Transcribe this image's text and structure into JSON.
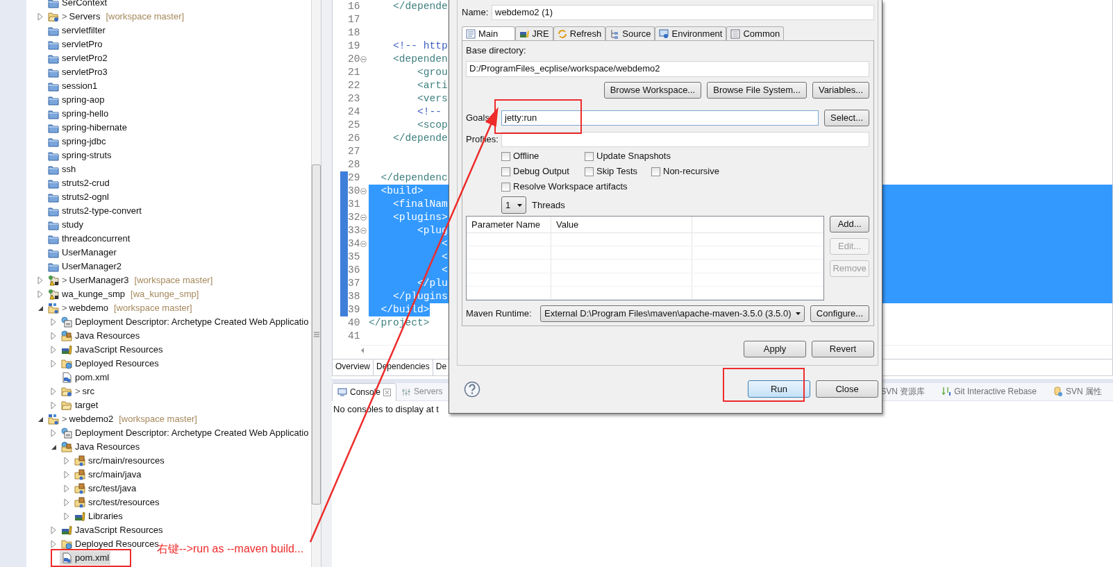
{
  "tree": {
    "items": [
      {
        "label": "SerContext",
        "kind": "closed-project",
        "selected": false
      },
      {
        "label": "Servers",
        "kind": "git-folder",
        "prefix": ">",
        "decoration": "[workspace master]",
        "expanded": false,
        "selected": false
      },
      {
        "label": "servletfilter",
        "kind": "closed-project",
        "selected": false
      },
      {
        "label": "servletPro",
        "kind": "closed-project",
        "selected": false
      },
      {
        "label": "servletPro2",
        "kind": "closed-project",
        "selected": false
      },
      {
        "label": "servletPro3",
        "kind": "closed-project",
        "selected": false
      },
      {
        "label": "session1",
        "kind": "closed-project",
        "selected": false
      },
      {
        "label": "spring-aop",
        "kind": "closed-project",
        "selected": false
      },
      {
        "label": "spring-hello",
        "kind": "closed-project",
        "selected": false
      },
      {
        "label": "spring-hibernate",
        "kind": "closed-project",
        "selected": false
      },
      {
        "label": "spring-jdbc",
        "kind": "closed-project",
        "selected": false
      },
      {
        "label": "spring-struts",
        "kind": "closed-project",
        "selected": false
      },
      {
        "label": "ssh",
        "kind": "closed-project",
        "selected": false
      },
      {
        "label": "struts2-crud",
        "kind": "closed-project",
        "selected": false
      },
      {
        "label": "struts2-ognl",
        "kind": "closed-project",
        "selected": false
      },
      {
        "label": "struts2-type-convert",
        "kind": "closed-project",
        "selected": false
      },
      {
        "label": "study",
        "kind": "closed-project",
        "selected": false
      },
      {
        "label": "threadconcurrent",
        "kind": "closed-project",
        "selected": false
      },
      {
        "label": "UserManager",
        "kind": "closed-project",
        "selected": false
      },
      {
        "label": "UserManager2",
        "kind": "closed-project",
        "selected": false
      },
      {
        "label": "UserManager3",
        "kind": "warn-project",
        "prefix": ">",
        "decoration": "[workspace master]",
        "expanded": false,
        "selected": false
      },
      {
        "label": "wa_kunge_smp",
        "kind": "warn-project",
        "decoration": "[wa_kunge_smp]",
        "expanded": false,
        "selected": false
      },
      {
        "label": "webdemo",
        "kind": "web-project",
        "prefix": ">",
        "decoration": "[workspace master]",
        "expanded": true,
        "selected": false,
        "children": [
          {
            "label": "Deployment Descriptor: Archetype Created Web Applicatio",
            "kind": "descriptor",
            "expanded": false,
            "selected": false
          },
          {
            "label": "Java Resources",
            "kind": "java-resources",
            "expanded": false,
            "selected": false
          },
          {
            "label": "JavaScript Resources",
            "kind": "books",
            "expanded": false,
            "selected": false
          },
          {
            "label": "Deployed Resources",
            "kind": "deployed",
            "expanded": false,
            "selected": false
          },
          {
            "label": "pom.xml",
            "kind": "xml-file",
            "selected": false
          },
          {
            "label": "src",
            "kind": "git-folder",
            "prefix": ">",
            "expanded": false,
            "selected": false
          },
          {
            "label": "target",
            "kind": "folder",
            "expanded": false,
            "selected": false
          }
        ]
      },
      {
        "label": "webdemo2",
        "kind": "web-project",
        "prefix": ">",
        "decoration": "[workspace master]",
        "expanded": true,
        "selected": false,
        "children": [
          {
            "label": "Deployment Descriptor: Archetype Created Web Applicatio",
            "kind": "descriptor",
            "expanded": false,
            "selected": false
          },
          {
            "label": "Java Resources",
            "kind": "java-resources",
            "expanded": true,
            "selected": false,
            "children": [
              {
                "label": "src/main/resources",
                "kind": "source-folder",
                "expanded": false,
                "selected": false
              },
              {
                "label": "src/main/java",
                "kind": "source-folder",
                "expanded": false,
                "selected": false
              },
              {
                "label": "src/test/java",
                "kind": "source-folder",
                "expanded": false,
                "selected": false
              },
              {
                "label": "src/test/resources",
                "kind": "source-folder",
                "expanded": false,
                "selected": false
              },
              {
                "label": "Libraries",
                "kind": "books",
                "expanded": false,
                "selected": false
              }
            ]
          },
          {
            "label": "JavaScript Resources",
            "kind": "books",
            "expanded": false,
            "selected": false
          },
          {
            "label": "Deployed Resources",
            "kind": "deployed",
            "expanded": false,
            "selected": false
          },
          {
            "label": "pom.xml",
            "kind": "xml-file",
            "selected": true
          }
        ]
      }
    ]
  },
  "editor": {
    "lines": [
      {
        "number": "16",
        "kind": "tag",
        "text": "    </depende",
        "foldable": false,
        "range_marked": false,
        "selected": false
      },
      {
        "number": "17",
        "foldable": false,
        "range_marked": false,
        "selected": false
      },
      {
        "number": "18",
        "foldable": false,
        "range_marked": false,
        "selected": false
      },
      {
        "number": "19",
        "kind": "comment",
        "text": "    <!-- http",
        "foldable": false,
        "range_marked": false,
        "selected": false
      },
      {
        "number": "20",
        "kind": "tag",
        "text": "    <dependen",
        "foldable": true,
        "range_marked": false,
        "selected": false
      },
      {
        "number": "21",
        "kind": "tag",
        "text": "        <grou",
        "foldable": false,
        "range_marked": false,
        "selected": false
      },
      {
        "number": "22",
        "kind": "tag",
        "text": "        <arti",
        "foldable": false,
        "range_marked": false,
        "selected": false
      },
      {
        "number": "23",
        "kind": "tag",
        "text": "        <vers",
        "foldable": false,
        "range_marked": false,
        "selected": false
      },
      {
        "number": "24",
        "kind": "comment",
        "text": "        <!--",
        "foldable": false,
        "range_marked": false,
        "selected": false
      },
      {
        "number": "25",
        "kind": "tag",
        "text": "        <scop",
        "foldable": false,
        "range_marked": false,
        "selected": false
      },
      {
        "number": "26",
        "kind": "tag",
        "text": "    </depende",
        "foldable": false,
        "range_marked": false,
        "selected": false
      },
      {
        "number": "27",
        "foldable": false,
        "range_marked": false,
        "selected": false
      },
      {
        "number": "28",
        "foldable": false,
        "range_marked": false,
        "selected": false
      },
      {
        "number": "29",
        "kind": "tag",
        "text": "  </dependenc",
        "foldable": false,
        "range_marked": true,
        "selected": false
      },
      {
        "number": "30",
        "kind": "tag",
        "text": "  <build>",
        "foldable": true,
        "range_marked": true,
        "selected": true
      },
      {
        "number": "31",
        "kind": "tag",
        "text": "    <finalNam",
        "foldable": false,
        "range_marked": true,
        "selected": true
      },
      {
        "number": "32",
        "kind": "tag",
        "text": "    <plugins>",
        "foldable": true,
        "range_marked": true,
        "selected": true
      },
      {
        "number": "33",
        "kind": "tag",
        "text": "        <plug",
        "foldable": true,
        "range_marked": true,
        "selected": true
      },
      {
        "number": "34",
        "kind": "tag",
        "text": "            <",
        "foldable": true,
        "range_marked": true,
        "selected": true
      },
      {
        "number": "35",
        "kind": "tag",
        "text": "            <",
        "foldable": false,
        "range_marked": true,
        "selected": true
      },
      {
        "number": "36",
        "kind": "tag",
        "text": "            <",
        "foldable": false,
        "range_marked": true,
        "selected": true
      },
      {
        "number": "37",
        "kind": "tag",
        "text": "        </plu",
        "foldable": false,
        "range_marked": true,
        "selected": true
      },
      {
        "number": "38",
        "kind": "tag",
        "text": "    </plugins",
        "foldable": false,
        "range_marked": true,
        "selected": true
      },
      {
        "number": "39",
        "kind": "tag",
        "text": "  </build>",
        "foldable": false,
        "range_marked": true,
        "selected": true
      },
      {
        "number": "40",
        "kind": "tag",
        "text": "</project>",
        "foldable": false,
        "range_marked": false,
        "selected": false
      },
      {
        "number": "41",
        "foldable": false,
        "range_marked": false,
        "selected": false
      }
    ],
    "tabs": [
      "Overview",
      "Dependencies",
      "De"
    ]
  },
  "console": {
    "tabs": [
      {
        "label": "Console",
        "selected": true,
        "closable": true
      },
      {
        "label": "Servers",
        "selected": false,
        "closable": false
      }
    ],
    "side_tabs": [
      "SVN 资源库",
      "Git Interactive Rebase",
      "SVN 属性"
    ],
    "message": "No consoles to display at t"
  },
  "dialog": {
    "name": {
      "label": "Name:",
      "value": "webdemo2 (1)"
    },
    "tabs": [
      {
        "label": "Main",
        "selected": true
      },
      {
        "label": "JRE",
        "selected": false
      },
      {
        "label": "Refresh",
        "selected": false
      },
      {
        "label": "Source",
        "selected": false
      },
      {
        "label": "Environment",
        "selected": false
      },
      {
        "label": "Common",
        "selected": false
      }
    ],
    "base_directory": {
      "label": "Base directory:",
      "value": "D:/ProgramFiles_ecplise/workspace/webdemo2"
    },
    "browse_buttons": [
      "Browse Workspace...",
      "Browse File System...",
      "Variables..."
    ],
    "goals": {
      "label": "Goals:",
      "value": "jetty:run",
      "focused": true
    },
    "select_button": "Select...",
    "profiles": {
      "label": "Profiles:"
    },
    "option_rows": [
      [
        {
          "label": "Offline",
          "checked": false
        },
        {
          "label": "Update Snapshots",
          "checked": false
        }
      ],
      [
        {
          "label": "Debug Output",
          "checked": false
        },
        {
          "label": "Skip Tests",
          "checked": false
        },
        {
          "label": "Non-recursive",
          "checked": false
        }
      ],
      [
        {
          "label": "Resolve Workspace artifacts",
          "checked": false
        }
      ]
    ],
    "threads": {
      "value": "1",
      "label": "Threads"
    },
    "parameters": {
      "columns": [
        "Parameter Name",
        "Value"
      ]
    },
    "table_buttons": [
      {
        "label": "Add...",
        "disabled": false
      },
      {
        "label": "Edit...",
        "disabled": true
      },
      {
        "label": "Remove",
        "disabled": true
      }
    ],
    "maven_runtime": {
      "label": "Maven Runtime:",
      "value": "External D:\\Program Files\\maven\\apache-maven-3.5.0 (3.5.0)"
    },
    "configure_button": "Configure...",
    "apply_buttons": [
      "Apply",
      "Revert"
    ],
    "footer_buttons": [
      {
        "label": "Run",
        "default": true
      },
      {
        "label": "Close",
        "default": false
      }
    ]
  },
  "annotation": {
    "note": "右键-->run as --maven build..."
  }
}
